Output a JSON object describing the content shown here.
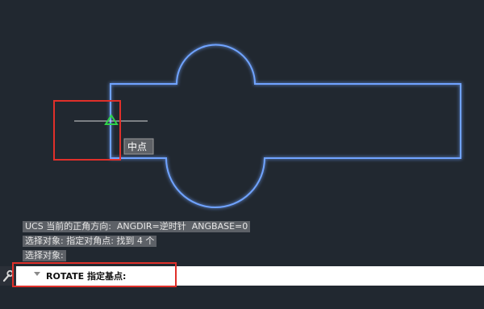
{
  "colors": {
    "canvas": "#212830",
    "shape_outline": "#6fa3ff",
    "glow": "#2b5cff",
    "snap_marker": "#2fd34a",
    "highlight": "#e0302a",
    "tooltip_bg": "#5e6166"
  },
  "tooltip": {
    "label": "中点"
  },
  "command_history": [
    "UCS 当前的正角方向:  ANGDIR=逆时针  ANGBASE=0",
    "选择对象: 指定对角点: 找到 4 个",
    "选择对象:"
  ],
  "command_line": {
    "prompt": "ROTATE 指定基点:",
    "tool_icon": "wrench-icon",
    "arrow_icon": "triangle-down-icon"
  }
}
